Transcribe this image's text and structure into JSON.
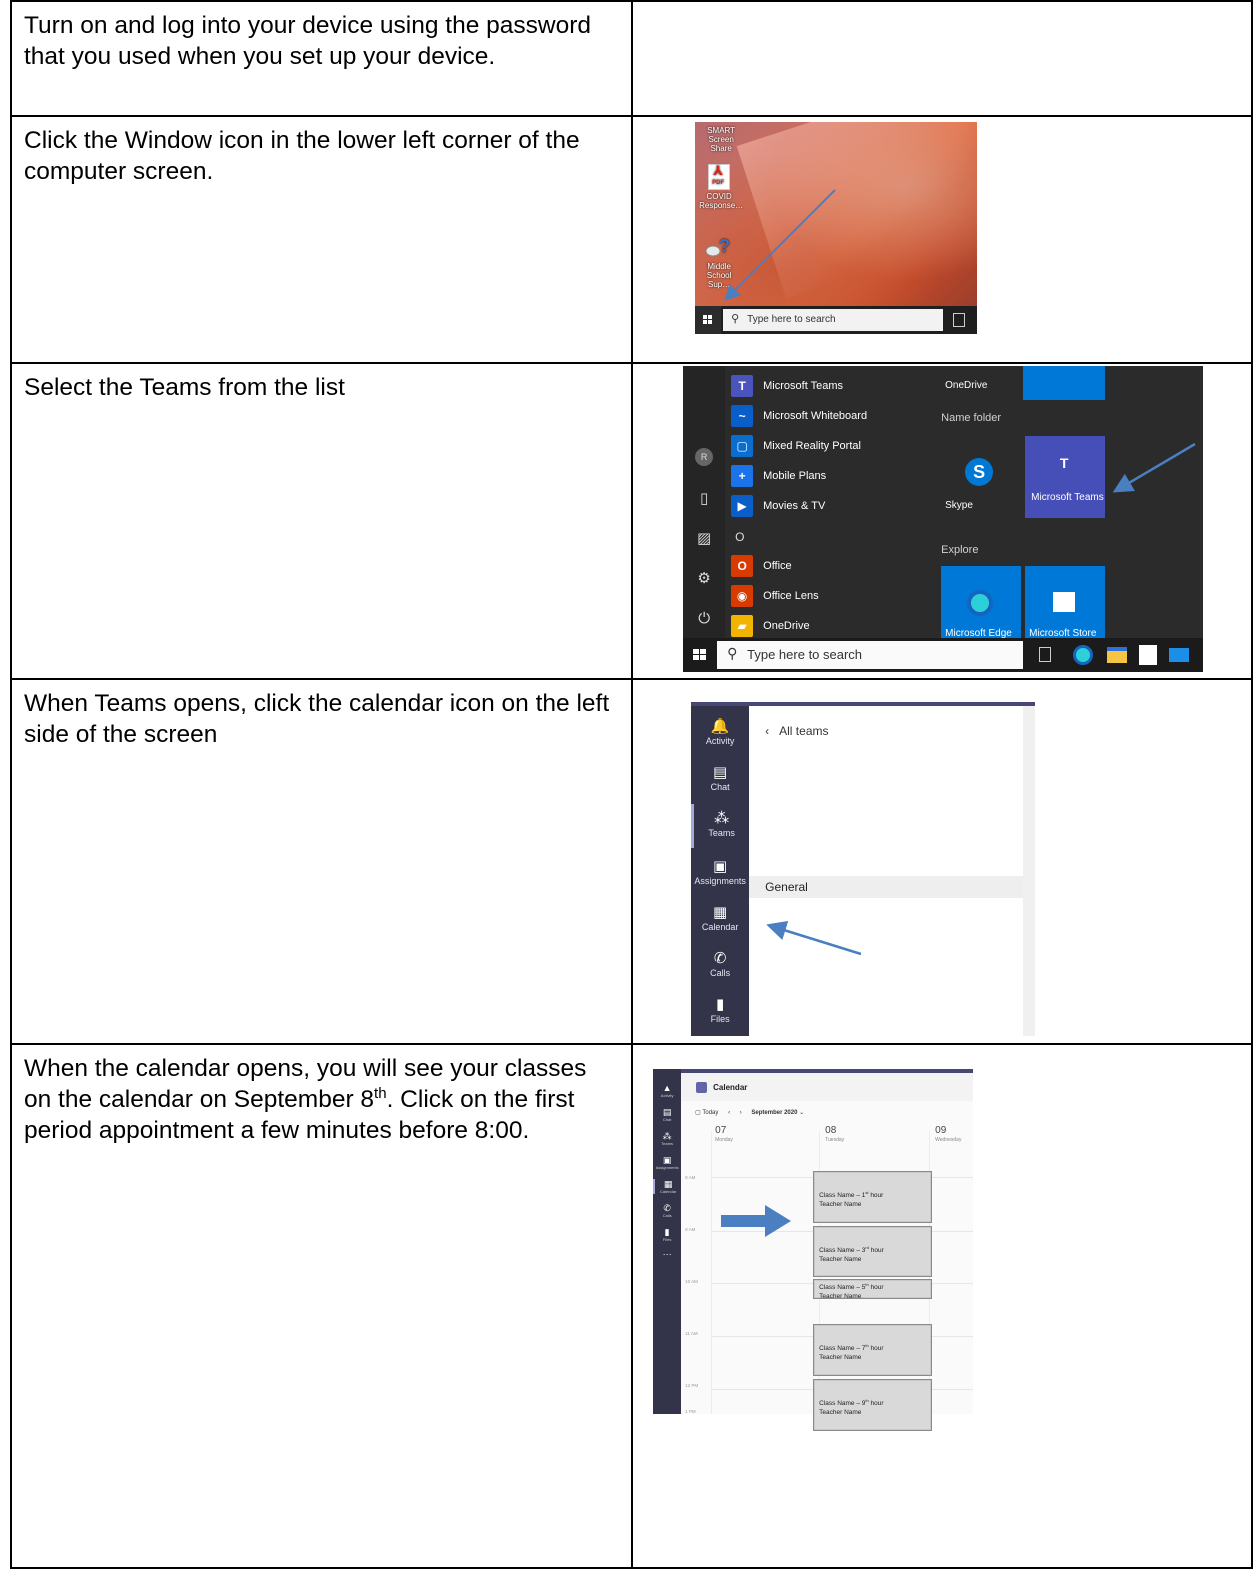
{
  "steps": [
    {
      "text": "Turn on and log into your device using the password that you used when you set up your device."
    },
    {
      "text": "Click the Window icon in the lower left corner of the computer screen.",
      "screenshot": {
        "desktop_icons": [
          {
            "label": "SMART Screen Share"
          },
          {
            "label": "COVID Response…",
            "badge": "PDF"
          },
          {
            "label": "Middle School Sup…"
          }
        ],
        "search_placeholder": "Type here to search"
      }
    },
    {
      "text": "Select the Teams from the list",
      "screenshot": {
        "apps": [
          {
            "label": "Microsoft Teams",
            "color": "#4b53bc",
            "glyph": "T"
          },
          {
            "label": "Microsoft Whiteboard",
            "color": "#0a5ec9",
            "glyph": "~"
          },
          {
            "label": "Mixed Reality Portal",
            "color": "#0a6ed1",
            "glyph": "▢"
          },
          {
            "label": "Mobile Plans",
            "color": "#1a73e8",
            "glyph": "+"
          },
          {
            "label": "Movies & TV",
            "color": "#0a5ec9",
            "glyph": "▶"
          },
          {
            "label": "Office",
            "color": "#d83b01",
            "glyph": "O"
          },
          {
            "label": "Office Lens",
            "color": "#d83b01",
            "glyph": "◉"
          },
          {
            "label": "OneDrive",
            "color": "#f1b400",
            "glyph": "▰"
          }
        ],
        "letter_heading": "O",
        "tiles": {
          "onedrive": "OneDrive",
          "name_folder": "Name folder",
          "skype": "Skype",
          "teams": "Microsoft Teams",
          "explore": "Explore",
          "edge": "Microsoft Edge",
          "store": "Microsoft Store"
        },
        "search_placeholder": "Type here to search"
      }
    },
    {
      "text": "When Teams opens, click the calendar icon on the left side of the screen",
      "screenshot": {
        "nav": [
          {
            "label": "Activity",
            "icon": "bell-icon",
            "glyph": "🔔"
          },
          {
            "label": "Chat",
            "icon": "chat-icon",
            "glyph": "▤"
          },
          {
            "label": "Teams",
            "icon": "teams-icon",
            "glyph": "⁂"
          },
          {
            "label": "Assignments",
            "icon": "assignments-icon",
            "glyph": "▣"
          },
          {
            "label": "Calendar",
            "icon": "calendar-icon",
            "glyph": "▦"
          },
          {
            "label": "Calls",
            "icon": "phone-icon",
            "glyph": "✆"
          },
          {
            "label": "Files",
            "icon": "file-icon",
            "glyph": "▮"
          }
        ],
        "back_label": "All teams",
        "channel": "General"
      }
    },
    {
      "text_before": "When the calendar opens, you will see your classes on the calendar on September 8",
      "text_sup": "th",
      "text_after": ".  Click on the first period appointment a few minutes before 8:00.",
      "screenshot": {
        "title": "Calendar",
        "today": "Today",
        "month": "September 2020",
        "days": [
          {
            "num": "07",
            "name": "Monday"
          },
          {
            "num": "08",
            "name": "Tuesday"
          },
          {
            "num": "09",
            "name": "Wednesday"
          }
        ],
        "hours": [
          "8 AM",
          "9 AM",
          "10 AM",
          "11 AM",
          "12 PM",
          "1 PM"
        ],
        "events": [
          {
            "class_name": "Class Name – 1",
            "sup": "st",
            "suffix": " hour",
            "teacher": "Teacher  Name"
          },
          {
            "class_name": "Class Name – 3",
            "sup": "rd",
            "suffix": " hour",
            "teacher": "Teacher  Name"
          },
          {
            "class_name": "Class Name – 5",
            "sup": "th",
            "suffix": " hour",
            "teacher": "Teacher  Name"
          },
          {
            "class_name": "Class Name – 7",
            "sup": "th",
            "suffix": " hour",
            "teacher": "Teacher  Name"
          },
          {
            "class_name": "Class Name – 9",
            "sup": "th",
            "suffix": " hour",
            "teacher": "Teacher  Name"
          }
        ]
      }
    }
  ],
  "colors": {
    "arrow": "#4a7fc1",
    "teams_purple": "#464775",
    "teams_sidebar": "#33344a"
  }
}
